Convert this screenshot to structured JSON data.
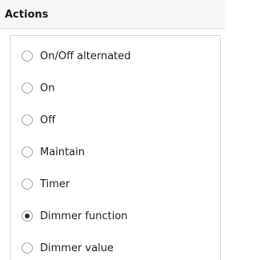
{
  "header": {
    "title": "Actions"
  },
  "actions": {
    "options": [
      {
        "label": "On/Off alternated",
        "checked": false
      },
      {
        "label": "On",
        "checked": false
      },
      {
        "label": "Off",
        "checked": false
      },
      {
        "label": "Maintain",
        "checked": false
      },
      {
        "label": "Timer",
        "checked": false
      },
      {
        "label": "Dimmer function",
        "checked": true
      },
      {
        "label": "Dimmer value",
        "checked": false
      }
    ]
  }
}
